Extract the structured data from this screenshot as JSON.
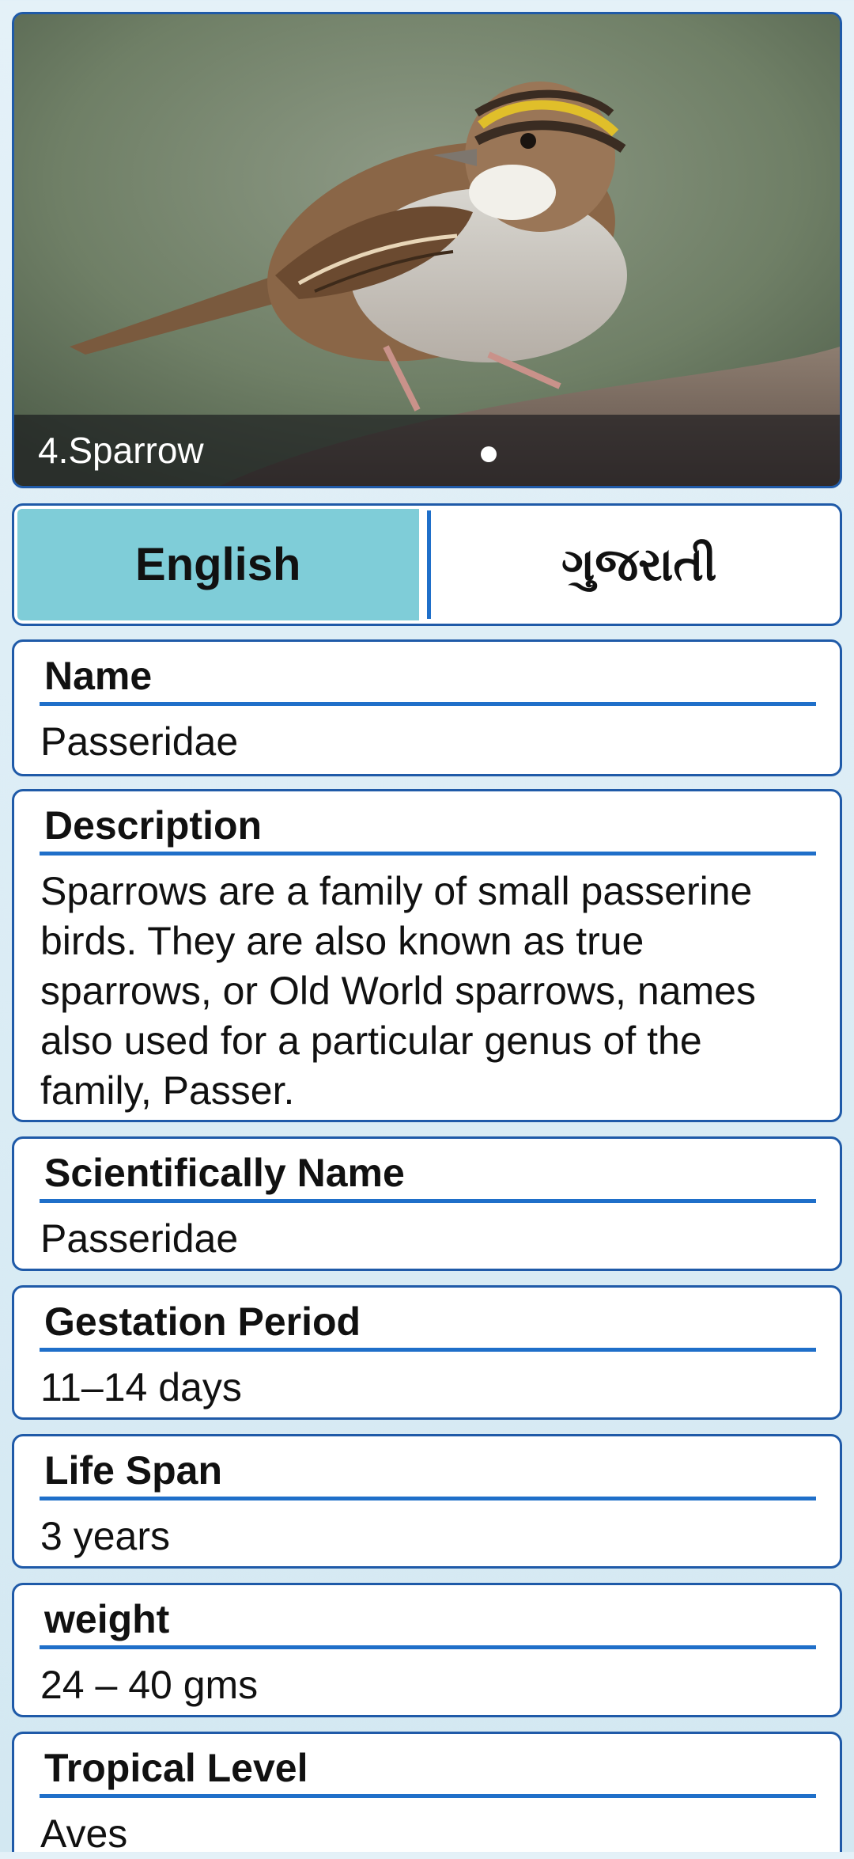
{
  "hero": {
    "caption": "4.Sparrow",
    "image_alt": "sparrow photo"
  },
  "language_toggle": {
    "english_label": "English",
    "gujarati_label": "ગુજરાતી",
    "active": "English"
  },
  "fields": {
    "name": {
      "title": "Name",
      "value": "Passeridae"
    },
    "description": {
      "title": "Description",
      "value": "Sparrows are a family of small passerine birds. They are also known as true sparrows, or Old World sparrows, names also used for a particular genus of the family, Passer."
    },
    "scientific_name": {
      "title": "Scientifically Name",
      "value": "Passeridae"
    },
    "gestation_period": {
      "title": "Gestation Period",
      "value": "11–14 days"
    },
    "life_span": {
      "title": "Life Span",
      "value": "3 years"
    },
    "weight": {
      "title": "weight",
      "value": "24 – 40 gms"
    },
    "tropical_level": {
      "title": "Tropical Level",
      "value": "Aves"
    }
  },
  "colors": {
    "border": "#1f5aa8",
    "rule": "#1f6fc9",
    "active_tab": "#7fcdd8"
  }
}
